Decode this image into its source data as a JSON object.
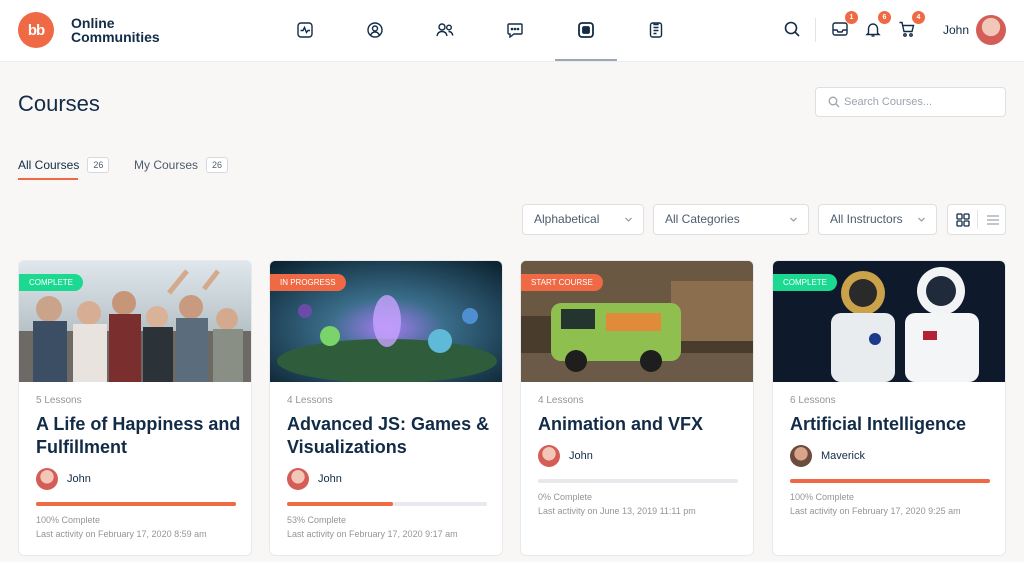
{
  "header": {
    "logo_text": "bb",
    "brand_line1": "Online",
    "brand_line2": "Communities",
    "nav": [
      {
        "icon": "activity-icon"
      },
      {
        "icon": "profile-icon"
      },
      {
        "icon": "members-icon"
      },
      {
        "icon": "forums-icon"
      },
      {
        "icon": "courses-icon",
        "active": true
      },
      {
        "icon": "documents-icon"
      }
    ],
    "search_icon": "search-icon",
    "messages_badge": "1",
    "notifications_badge": "6",
    "cart_badge": "4",
    "user_name": "John"
  },
  "page": {
    "title": "Courses",
    "search_placeholder": "Search Courses...",
    "tabs": [
      {
        "label": "All Courses",
        "count": "26",
        "active": true
      },
      {
        "label": "My Courses",
        "count": "26"
      }
    ],
    "filters": {
      "sort": "Alphabetical",
      "category": "All Categories",
      "instructor": "All Instructors"
    }
  },
  "colors": {
    "accent": "#ef6944",
    "complete": "#1cd991",
    "text": "#122b46"
  },
  "courses": [
    {
      "status": "Complete",
      "lessons": "5 Lessons",
      "title": "A Life of Happiness and Fulfillment",
      "author": "John",
      "progress": 100,
      "progress_text": "100% Complete",
      "last_activity": "Last activity on February 17, 2020 8:59 am"
    },
    {
      "status": "In Progress",
      "lessons": "4 Lessons",
      "title": "Advanced JS: Games & Visualizations",
      "author": "John",
      "progress": 53,
      "progress_text": "53% Complete",
      "last_activity": "Last activity on February 17, 2020 9:17 am"
    },
    {
      "status": "Start Course",
      "lessons": "4 Lessons",
      "title": "Animation and VFX",
      "author": "John",
      "progress": 0,
      "progress_text": "0% Complete",
      "last_activity": "Last activity on June 13, 2019 11:11 pm"
    },
    {
      "status": "Complete",
      "lessons": "6 Lessons",
      "title": "Artificial Intelligence",
      "author": "Maverick",
      "progress": 100,
      "progress_text": "100% Complete",
      "last_activity": "Last activity on February 17, 2020 9:25 am"
    }
  ]
}
